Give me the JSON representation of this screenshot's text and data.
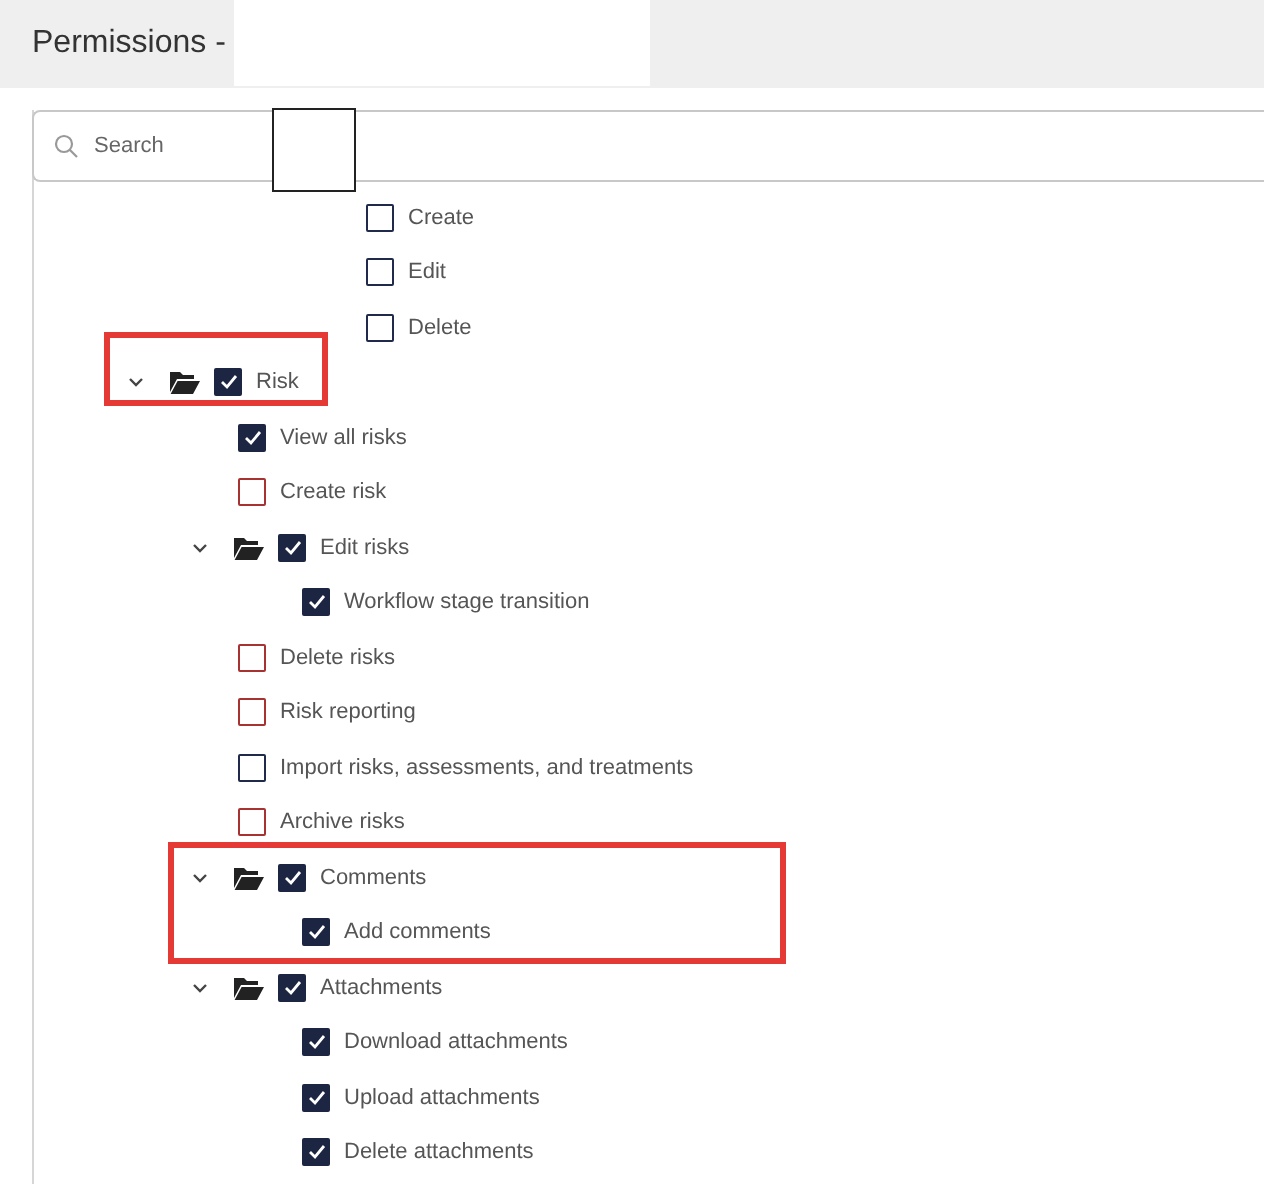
{
  "header": {
    "title": "Permissions -"
  },
  "search": {
    "placeholder": "Search"
  },
  "tree": {
    "clipped_items": [
      {
        "label": "Create",
        "checked": false,
        "color": "#1f2a4d"
      },
      {
        "label": "Edit",
        "checked": false,
        "color": "#1f2a4d"
      },
      {
        "label": "Delete",
        "checked": false,
        "color": "#1f2a4d"
      }
    ],
    "items": [
      {
        "label": "Risk",
        "checked": true,
        "color": "#1c2541",
        "expanded": true,
        "children": [
          {
            "label": "View all risks",
            "checked": true,
            "color": "#1c2541"
          },
          {
            "label": "Create risk",
            "checked": false,
            "color": "#a83232"
          },
          {
            "label": "Edit risks",
            "checked": true,
            "color": "#1c2541",
            "expanded": true,
            "children": [
              {
                "label": "Workflow stage transition",
                "checked": true,
                "color": "#1c2541"
              }
            ]
          },
          {
            "label": "Delete risks",
            "checked": false,
            "color": "#a83232"
          },
          {
            "label": "Risk reporting",
            "checked": false,
            "color": "#a83232"
          },
          {
            "label": "Import risks, assessments, and treatments",
            "checked": false,
            "color": "#1f2a4d"
          },
          {
            "label": "Archive risks",
            "checked": false,
            "color": "#a83232"
          },
          {
            "label": "Comments",
            "checked": true,
            "color": "#1c2541",
            "expanded": true,
            "children": [
              {
                "label": "Add comments",
                "checked": true,
                "color": "#1c2541"
              }
            ]
          },
          {
            "label": "Attachments",
            "checked": true,
            "color": "#1c2541",
            "expanded": true,
            "children": [
              {
                "label": "Download attachments",
                "checked": true,
                "color": "#1c2541"
              },
              {
                "label": "Upload attachments",
                "checked": true,
                "color": "#1c2541"
              },
              {
                "label": "Delete attachments",
                "checked": true,
                "color": "#1c2541"
              }
            ]
          }
        ]
      }
    ]
  }
}
